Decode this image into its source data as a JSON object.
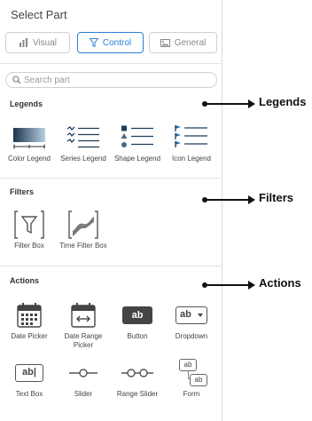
{
  "panel": {
    "title": "Select Part",
    "tabs": [
      {
        "label": "Visual",
        "icon": "bar-chart-icon",
        "active": false
      },
      {
        "label": "Control",
        "icon": "filter-funnel-icon",
        "active": true
      },
      {
        "label": "General",
        "icon": "image-icon",
        "active": false
      }
    ],
    "search": {
      "placeholder": "Search part",
      "value": ""
    }
  },
  "sections": {
    "legends": {
      "title": "Legends",
      "items": [
        {
          "label": "Color Legend",
          "icon": "color-legend-icon"
        },
        {
          "label": "Series Legend",
          "icon": "series-legend-icon"
        },
        {
          "label": "Shape Legend",
          "icon": "shape-legend-icon"
        },
        {
          "label": "Icon Legend",
          "icon": "icon-legend-icon"
        }
      ]
    },
    "filters": {
      "title": "Filters",
      "items": [
        {
          "label": "Filter Box",
          "icon": "filter-box-icon"
        },
        {
          "label": "Time Filter Box",
          "icon": "time-filter-box-icon"
        }
      ]
    },
    "actions": {
      "title": "Actions",
      "items": [
        {
          "label": "Date Picker",
          "icon": "calendar-icon"
        },
        {
          "label": "Date Range Picker",
          "icon": "date-range-icon"
        },
        {
          "label": "Button",
          "icon": "button-icon",
          "glyph": "ab"
        },
        {
          "label": "Dropdown",
          "icon": "dropdown-icon",
          "glyph": "ab"
        },
        {
          "label": "Text Box",
          "icon": "text-box-icon",
          "glyph": "ab|"
        },
        {
          "label": "Slider",
          "icon": "slider-icon"
        },
        {
          "label": "Range Slider",
          "icon": "range-slider-icon"
        },
        {
          "label": "Form",
          "icon": "form-icon",
          "glyph": "ab"
        }
      ]
    }
  },
  "annotations": {
    "legends": "Legends",
    "filters": "Filters",
    "actions": "Actions"
  },
  "colors": {
    "accent": "#2a7fd8",
    "icon_dark": "#1f3d5a",
    "icon_mid": "#4a6a86"
  }
}
